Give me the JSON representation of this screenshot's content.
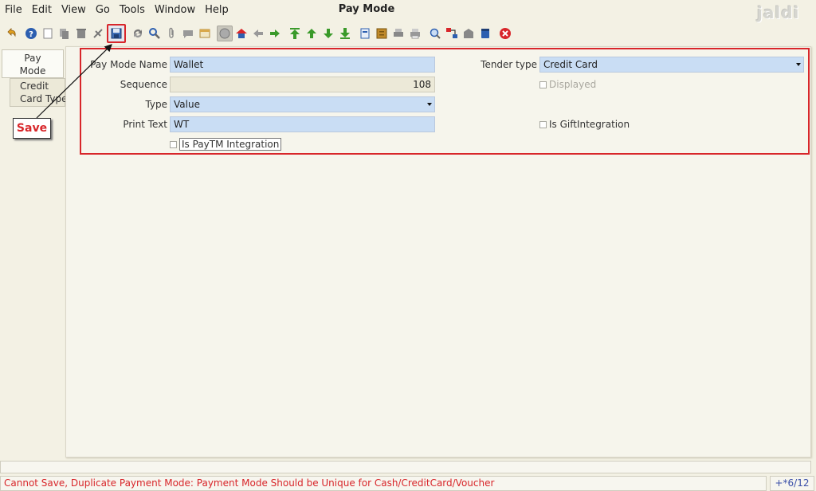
{
  "menu": {
    "items": [
      {
        "label": "File"
      },
      {
        "label": "Edit"
      },
      {
        "label": "View"
      },
      {
        "label": "Go"
      },
      {
        "label": "Tools"
      },
      {
        "label": "Window"
      },
      {
        "label": "Help"
      }
    ]
  },
  "window": {
    "title": "Pay Mode",
    "brand": "jaldi"
  },
  "toolbar": {
    "icons": [
      "undo-icon",
      "help-icon",
      "new-icon",
      "copy-icon",
      "delete-icon",
      "delete-selection-icon",
      "save-icon",
      "refresh-icon",
      "find-icon",
      "attachment-icon",
      "chat-icon",
      "history-icon",
      "grid-toggle-icon",
      "home-icon",
      "back-icon",
      "forward-icon",
      "first-record-icon",
      "previous-record-icon",
      "next-record-icon",
      "last-record-icon",
      "report-icon",
      "archive-icon",
      "print-preview-icon",
      "print-icon",
      "zoom-across-icon",
      "workflow-icon",
      "request-icon",
      "product-info-icon",
      "close-icon"
    ]
  },
  "tabs": [
    {
      "label": "Pay Mode"
    },
    {
      "label": "Credit Card Type"
    }
  ],
  "annotation": {
    "label": "Save"
  },
  "form": {
    "pay_mode_name": {
      "label": "Pay Mode Name",
      "value": "Wallet"
    },
    "sequence": {
      "label": "Sequence",
      "value": "108"
    },
    "type": {
      "label": "Type",
      "value": "Value"
    },
    "print_text": {
      "label": "Print Text",
      "value": "WT"
    },
    "is_paytm_integration": {
      "label": "Is PayTM Integration",
      "checked": false
    },
    "tender_type": {
      "label": "Tender type",
      "value": "Credit Card"
    },
    "displayed": {
      "label": "Displayed",
      "checked": false
    },
    "is_gift_integration": {
      "label": "Is GiftIntegration",
      "checked": false
    }
  },
  "status": {
    "message": "Cannot Save, Duplicate Payment Mode: Payment Mode Should be Unique for Cash/CreditCard/Voucher",
    "record_count": "+*6/12"
  },
  "colors": {
    "accent_red": "#d8262a",
    "field_blue": "#c9ddf4",
    "record_blue": "#3a4fa8"
  }
}
